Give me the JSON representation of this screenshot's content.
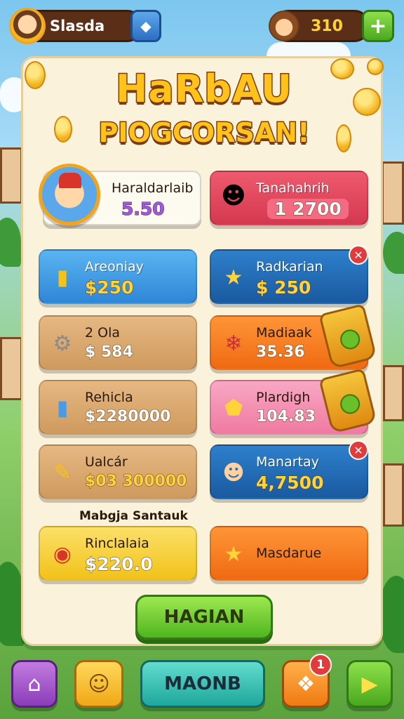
{
  "header": {
    "player_name": "Slasda",
    "gem_icon": "diamond-icon",
    "coins": "310",
    "plus_label": "+"
  },
  "panel": {
    "title_line1": "HaRbAU",
    "title_line2": "PIOGCORSAN!",
    "cards": [
      {
        "label": "Haraldarlaib",
        "value": "5.50",
        "icon": "hero-portrait"
      },
      {
        "label": "Tanahahrih",
        "value": "1 2700",
        "icon": "villager-icon"
      },
      {
        "label": "Areoniay",
        "value": "$250",
        "icon": "gold-bars-icon"
      },
      {
        "label": "Radkarian",
        "value": "$ 250",
        "icon": "star-icon"
      },
      {
        "label": "2 Ola",
        "value": "$ 584",
        "icon": "gears-icon"
      },
      {
        "label": "Madiaak",
        "value": "35.36",
        "icon": "meat-icon"
      },
      {
        "label": "Rehicla",
        "value": "$2280000",
        "icon": "pipe-icon"
      },
      {
        "label": "Plardigh",
        "value": "104.83",
        "icon": "crystal-icon"
      },
      {
        "label": "Ualcár",
        "value": "$03 300000",
        "icon": "crayon-icon"
      },
      {
        "label": "Manartay",
        "value": "4,7500",
        "icon": "farmer-icon"
      },
      {
        "label": "Rinclalaia",
        "value": "$220.0",
        "icon": "drum-icon"
      },
      {
        "label": "Masdarue",
        "value": "",
        "icon": "star-icon"
      }
    ],
    "section_label": "Mabgja Santauk",
    "main_button": "HAGIAN"
  },
  "bottom_nav": {
    "home_icon": "home-icon",
    "smile_icon": "smile-icon",
    "main_label": "MAONB",
    "puzzle_icon": "puzzle-icon",
    "puzzle_badge": "1",
    "play_icon": "play-icon"
  },
  "colors": {
    "cream": "#fbf2dc",
    "blue": "#3f9be6",
    "red": "#e8475a",
    "orange": "#f77e1e",
    "tan": "#d9a96a",
    "pink": "#f48fb1",
    "navy": "#1f6fb8",
    "yellow": "#f7d94a",
    "green": "#5bc024"
  }
}
